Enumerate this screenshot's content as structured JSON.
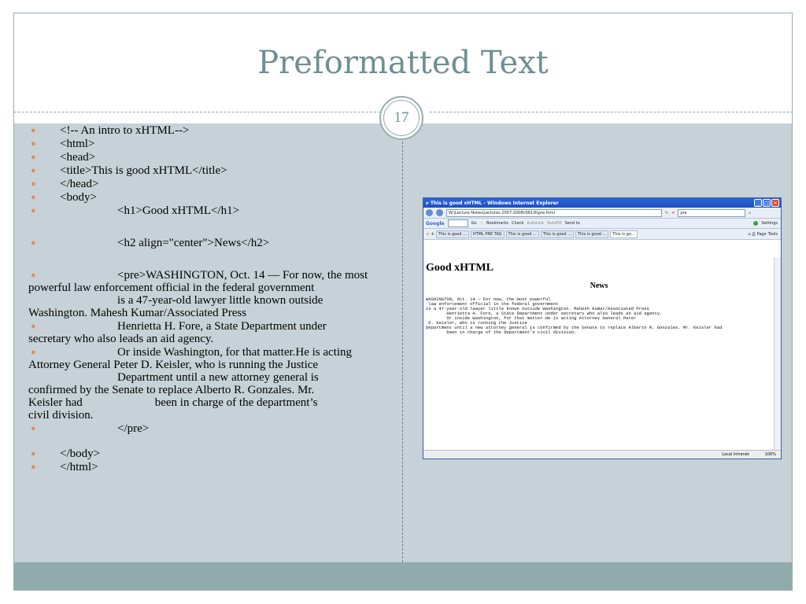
{
  "slide": {
    "title": "Preformatted Text",
    "page_number": "17"
  },
  "bullets": [
    {
      "text": "<!-- An intro to xHTML-->"
    },
    {
      "text": "<html>"
    },
    {
      "text": "<head>"
    },
    {
      "text": "<title>This is good xHTML</title>"
    },
    {
      "text": "</head>"
    },
    {
      "text": "<body>"
    },
    {
      "text": "<h1>Good xHTML</h1>"
    },
    {
      "text": "<h2 align=\"center\">News</h2>"
    },
    {
      "text": "<pre>WASHINGTON, Oct. 14 — For now, the most",
      "cont1": "powerful law enforcement official in the federal government",
      "cont2": "is a 47-year-old lawyer little known outside",
      "cont3": "Washington. Mahesh Kumar/Associated Press"
    },
    {
      "text": "Henrietta H. Fore, a State Department under",
      "cont1": "secretary who also leads an aid agency."
    },
    {
      "text": "Or inside Washington, for that matter.He is acting",
      "cont1": "Attorney General Peter D. Keisler, who is running the Justice",
      "cont2": "Department until a new attorney general is",
      "cont3": "confirmed by the Senate to replace Alberto R. Gonzales. Mr.",
      "cont4": "Keisler had",
      "cont5": "been in charge of the department’s",
      "cont6": "civil division."
    },
    {
      "text": "</pre>"
    },
    {
      "text": "</body>"
    },
    {
      "text": "</html>"
    }
  ],
  "browser": {
    "window_title": "This is good xHTML - Windows Internet Explorer",
    "address": "W:\\Lecture Notes\\Lectures 2007-2008\\IS61\\6\\pre.html",
    "search_text": "pre",
    "google_label": "Google",
    "go_label": "Go",
    "bookmarks_label": "Bookmarks",
    "check_label": "Check",
    "autolink_label": "AutoLink",
    "autofill_label": "AutoFill",
    "sendto_label": "Send to",
    "settings_label": "Settings",
    "tabs": [
      "This is good ...",
      "HTML PRE TAG",
      "This is good ...",
      "This is good ...",
      "This is good ...",
      "This is go..."
    ],
    "page_label": "Page",
    "tools_label": "Tools",
    "page_h1": "Good xHTML",
    "page_h2": "News",
    "page_pre": "WASHINGTON, Oct. 14 — For now, the most powerful\n law enforcement official in the federal government\nis a 47-year-old lawyer little known outside Washington. Mahesh Kumar/Associated Press\n        Henrietta H. Fore, a State Department under secretary who also leads an aid agency.\n        Or inside Washington, for that matter.He is acting Attorney General Peter\n D. Keisler, who is running the Justice\nDepartment until a new attorney general is confirmed by the Senate to replace Alberto R. Gonzales. Mr. Keisler had\n        been in charge of the department’s civil division.",
    "status_zone": "Local intranet",
    "status_zoom": "100%"
  }
}
